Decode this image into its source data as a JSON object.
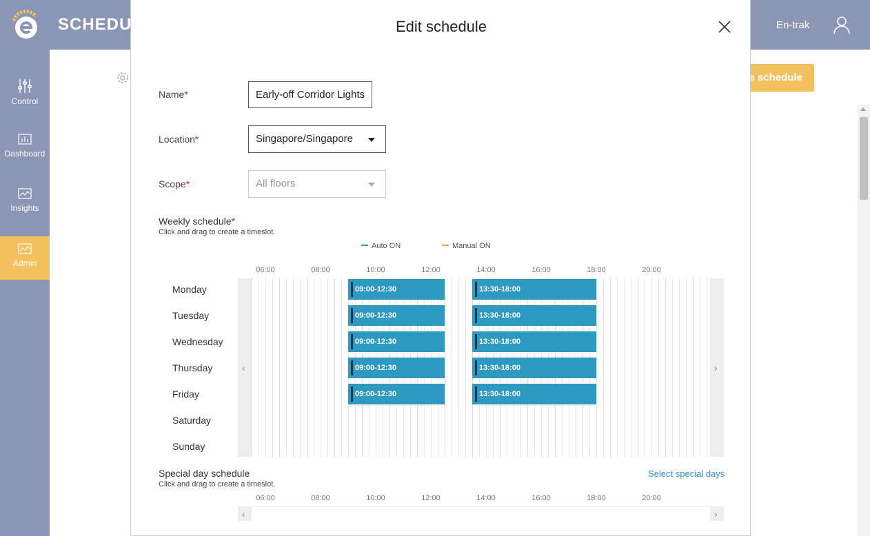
{
  "app": {
    "title": "SCHEDUL",
    "user_name": "En-trak",
    "create_button_label": "e schedule"
  },
  "sidebar": {
    "items": [
      {
        "label": "Control",
        "icon": "sliders-icon",
        "active": false
      },
      {
        "label": "Dashboard",
        "icon": "dashboard-icon",
        "active": false
      },
      {
        "label": "Insights",
        "icon": "insights-icon",
        "active": false
      },
      {
        "label": "Admin",
        "icon": "admin-icon",
        "active": true
      }
    ]
  },
  "modal": {
    "title": "Edit schedule",
    "fields": {
      "name": {
        "label": "Name",
        "value": "Early-off Corridor Lights"
      },
      "location": {
        "label": "Location",
        "value": "Singapore/Singapore"
      },
      "scope": {
        "label": "Scope",
        "placeholder": "All floors"
      }
    },
    "weekly": {
      "title": "Weekly schedule",
      "hint": "Click and drag to create a timeslot.",
      "legend": [
        {
          "label": "Auto ON",
          "color": "#2f9ac1"
        },
        {
          "label": "Manual ON",
          "color": "#f0a030"
        }
      ],
      "hours": [
        "06:00",
        "08:00",
        "10:00",
        "12:00",
        "14:00",
        "16:00",
        "18:00",
        "20:00"
      ],
      "days": [
        "Monday",
        "Tuesday",
        "Wednesday",
        "Thursday",
        "Friday",
        "Saturday",
        "Sunday"
      ],
      "slots": [
        [
          "09:00-12:30",
          "13:30-18:00"
        ],
        [
          "09:00-12:30",
          "13:30-18:00"
        ],
        [
          "09:00-12:30",
          "13:30-18:00"
        ],
        [
          "09:00-12:30",
          "13:30-18:00"
        ],
        [
          "09:00-12:30",
          "13:30-18:00"
        ],
        [],
        []
      ]
    },
    "special": {
      "title": "Special day schedule",
      "hint": "Click and drag to create a timeslot.",
      "link": "Select special days",
      "hours": [
        "06:00",
        "08:00",
        "10:00",
        "12:00",
        "14:00",
        "16:00",
        "18:00",
        "20:00"
      ]
    }
  }
}
